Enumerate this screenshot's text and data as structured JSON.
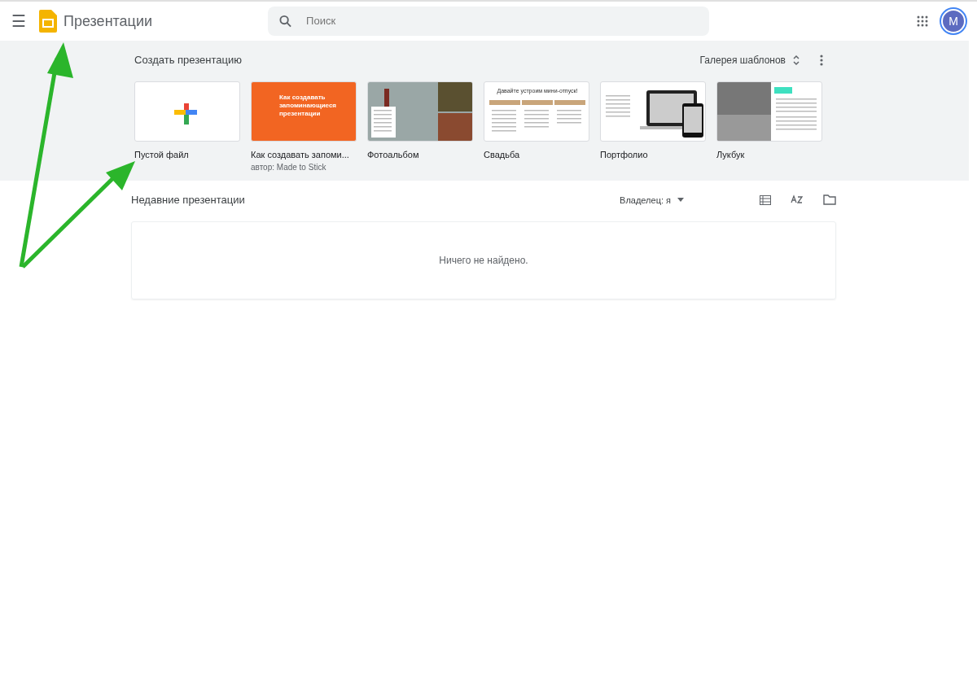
{
  "header": {
    "menu": "☰",
    "app_title": "Презентации",
    "search": {
      "placeholder": "Поиск"
    },
    "avatar": "M"
  },
  "templates": {
    "title": "Создать презентацию",
    "gallery_label": "Галерея шаблонов",
    "items": [
      {
        "kind": "blank",
        "name": "Пустой файл"
      },
      {
        "kind": "orange",
        "name": "Как создавать запоми...",
        "author": "автор: Made to Stick",
        "thumb_text": "Как создавать запоминающиеся презентации"
      },
      {
        "kind": "photo",
        "name": "Фотоальбом"
      },
      {
        "kind": "wedding",
        "name": "Свадьба",
        "thumb_text": "Давайте устроим мини-отпуск!"
      },
      {
        "kind": "portfolio",
        "name": "Портфолио"
      },
      {
        "kind": "lookbook",
        "name": "Лукбук"
      }
    ]
  },
  "recent": {
    "title": "Недавние презентации",
    "owner_filter": "Владелец: я",
    "empty_message": "Ничего не найдено."
  }
}
